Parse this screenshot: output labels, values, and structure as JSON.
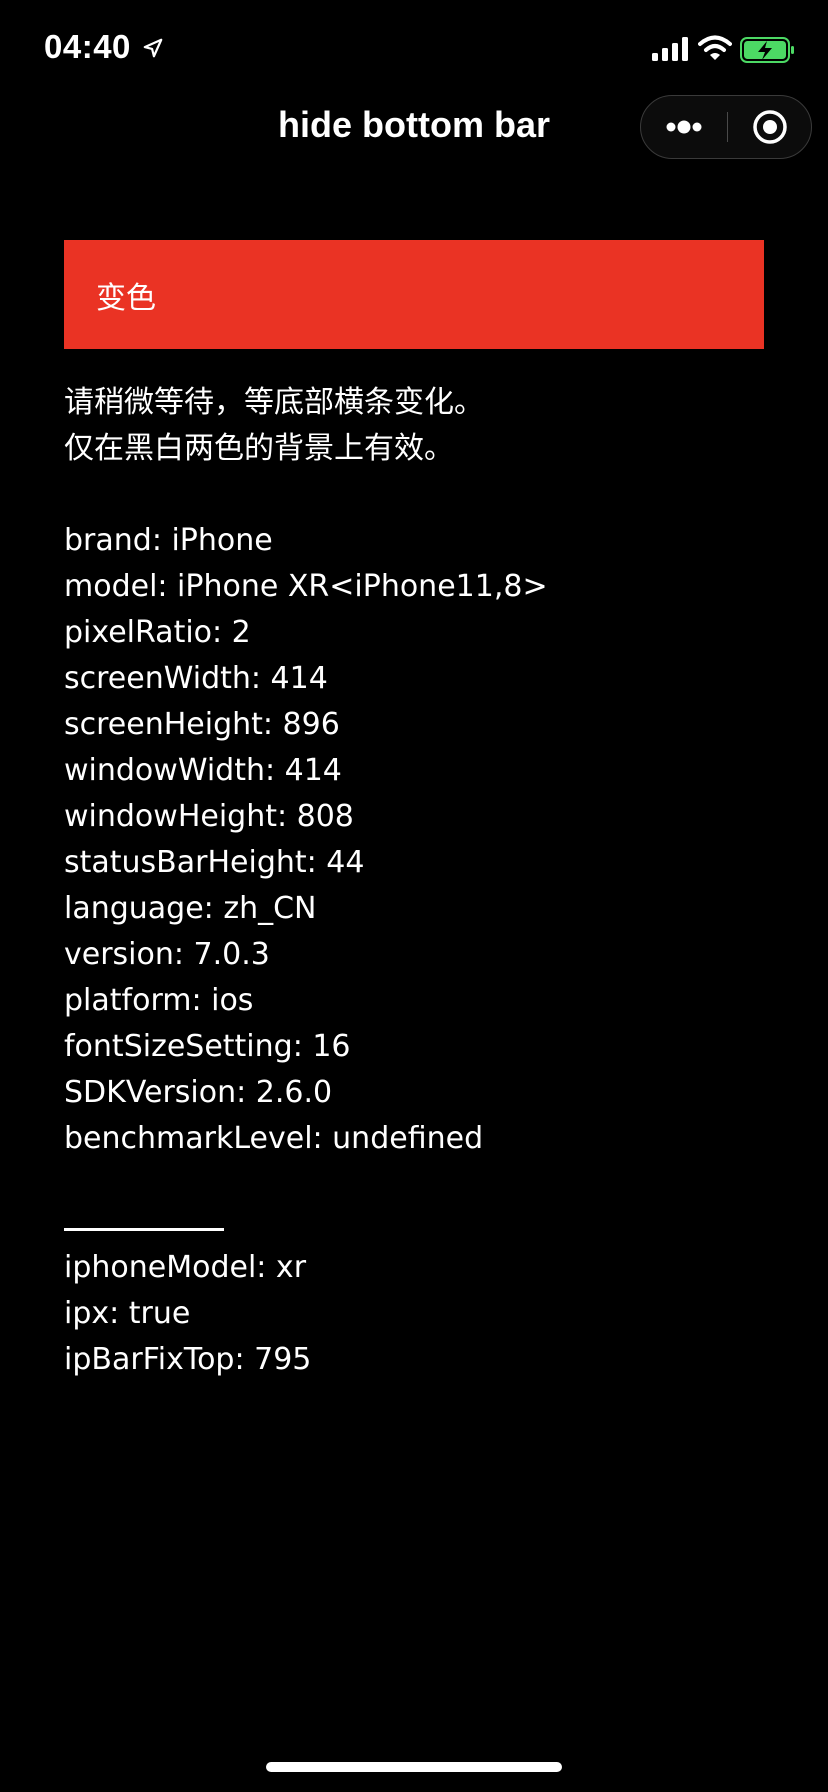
{
  "status_bar": {
    "time": "04:40",
    "icons": [
      "location-icon",
      "signal-icon",
      "wifi-icon",
      "battery-charging-icon"
    ],
    "battery_color": "#4cd964"
  },
  "nav": {
    "title": "hide bottom bar",
    "capsule_icons": [
      "more-icon",
      "close-target-icon"
    ]
  },
  "button": {
    "label": "变色",
    "color": "#ea3324"
  },
  "notice": {
    "line1": "请稍微等待，等底部横条变化。",
    "line2": "仅在黑白两色的背景上有效。"
  },
  "system_info": [
    "brand: iPhone",
    "model: iPhone XR<iPhone11,8>",
    "pixelRatio: 2",
    "screenWidth: 414",
    "screenHeight: 896",
    "windowWidth: 414",
    "windowHeight: 808",
    "statusBarHeight: 44",
    "language: zh_CN",
    "version: 7.0.3",
    "platform: ios",
    "fontSizeSetting: 16",
    "SDKVersion: 2.6.0",
    "benchmarkLevel: undefined"
  ],
  "extra_info": [
    "iphoneModel: xr",
    "ipx: true",
    "ipBarFixTop: 795"
  ]
}
